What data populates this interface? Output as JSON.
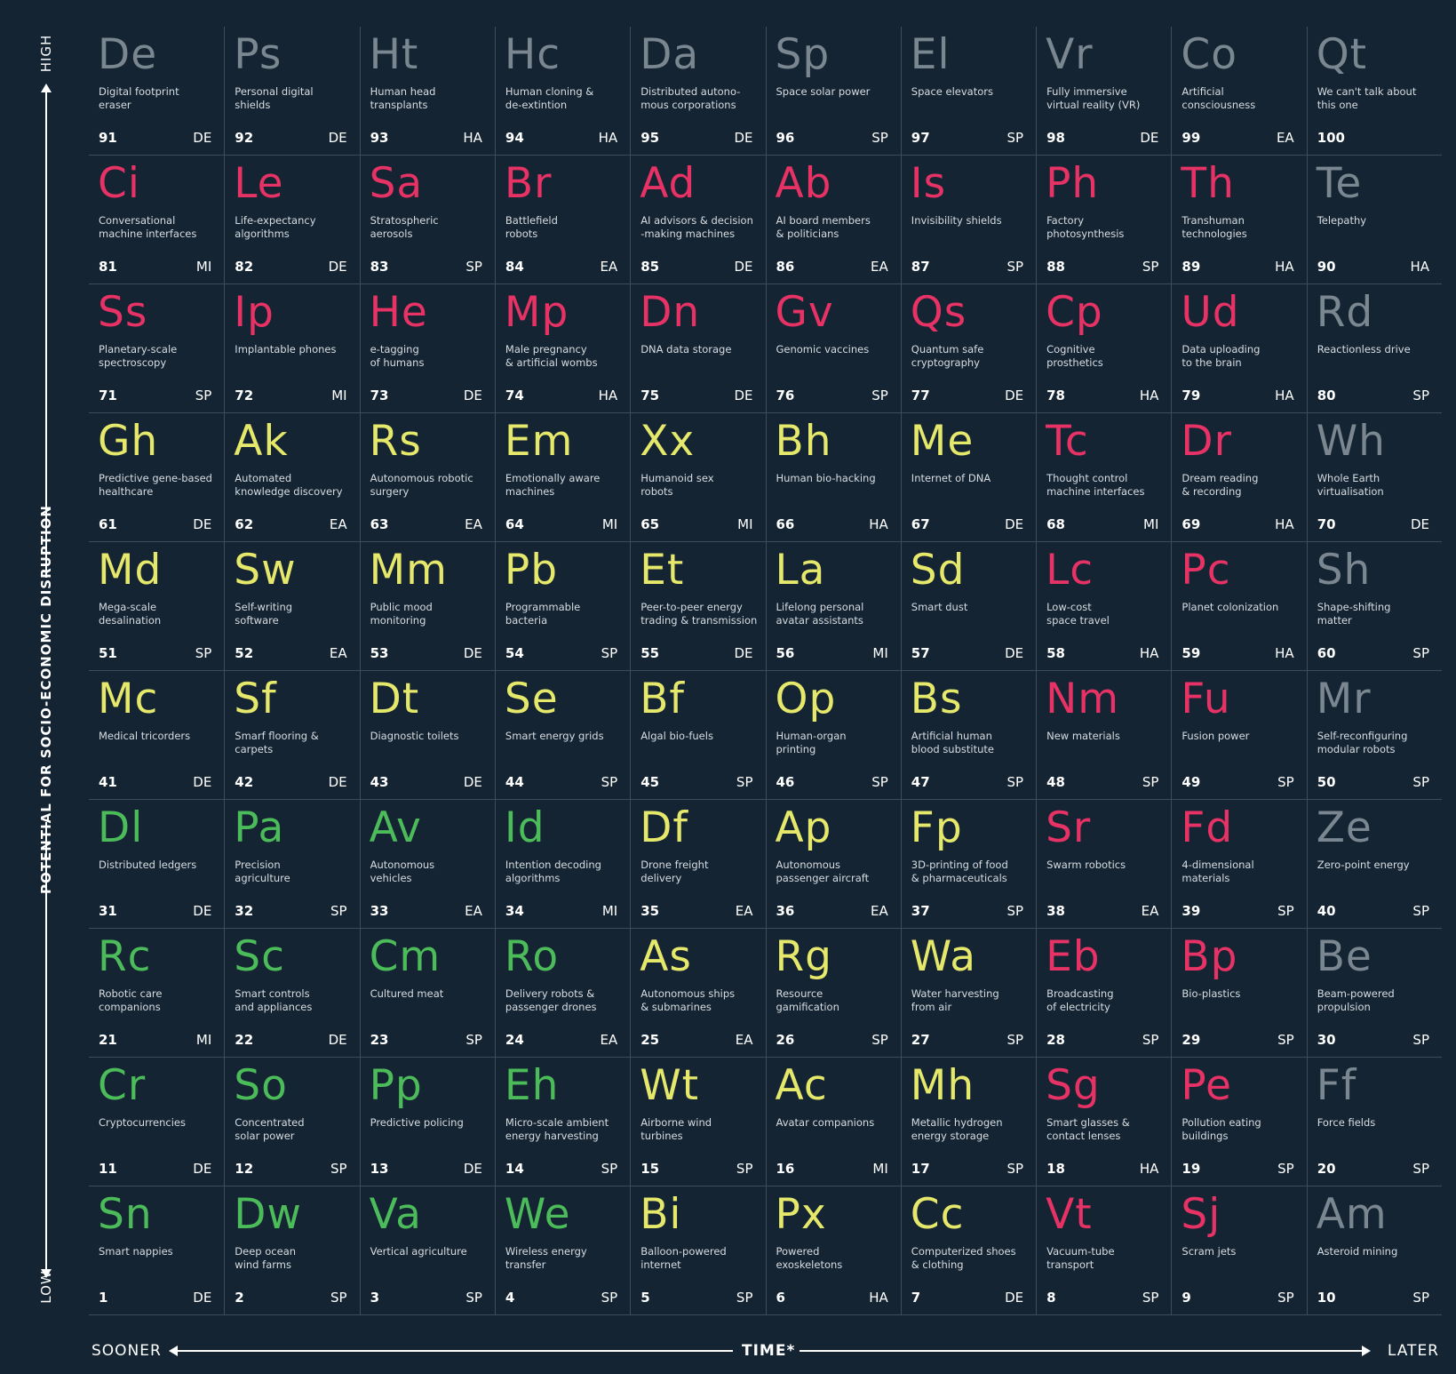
{
  "axis": {
    "y_high": "HIGH",
    "y_low": "LOW",
    "y_label": "POTENTIAL FOR SOCIO-ECONOMIC DISRUPTION",
    "x_sooner": "SOONER",
    "x_later": "LATER",
    "x_label": "TIME*"
  },
  "colors": {
    "background": "#142432",
    "gray": "#7a8690",
    "pink": "#e63265",
    "yellow": "#e5e86a",
    "green": "#4cbb5a"
  },
  "elements": [
    {
      "symbol": "De",
      "name": "Digital footprint\neraser",
      "number": "91",
      "category": "DE",
      "color": "gray"
    },
    {
      "symbol": "Ps",
      "name": "Personal digital\nshields",
      "number": "92",
      "category": "DE",
      "color": "gray"
    },
    {
      "symbol": "Ht",
      "name": "Human head\ntransplants",
      "number": "93",
      "category": "HA",
      "color": "gray"
    },
    {
      "symbol": "Hc",
      "name": "Human cloning &\nde-extintion",
      "number": "94",
      "category": "HA",
      "color": "gray"
    },
    {
      "symbol": "Da",
      "name": "Distributed autono-\nmous corporations",
      "number": "95",
      "category": "DE",
      "color": "gray"
    },
    {
      "symbol": "Sp",
      "name": "Space solar power",
      "number": "96",
      "category": "SP",
      "color": "gray"
    },
    {
      "symbol": "El",
      "name": "Space elevators",
      "number": "97",
      "category": "SP",
      "color": "gray"
    },
    {
      "symbol": "Vr",
      "name": "Fully immersive\nvirtual reality (VR)",
      "number": "98",
      "category": "DE",
      "color": "gray"
    },
    {
      "symbol": "Co",
      "name": "Artificial\nconsciousness",
      "number": "99",
      "category": "EA",
      "color": "gray"
    },
    {
      "symbol": "Qt",
      "name": "We can't talk about\nthis one",
      "number": "100",
      "category": "",
      "color": "gray"
    },
    {
      "symbol": "Ci",
      "name": "Conversational\nmachine interfaces",
      "number": "81",
      "category": "MI",
      "color": "pink"
    },
    {
      "symbol": "Le",
      "name": "Life-expectancy\nalgorithms",
      "number": "82",
      "category": "DE",
      "color": "pink"
    },
    {
      "symbol": "Sa",
      "name": "Stratospheric\naerosols",
      "number": "83",
      "category": "SP",
      "color": "pink"
    },
    {
      "symbol": "Br",
      "name": "Battlefield\nrobots",
      "number": "84",
      "category": "EA",
      "color": "pink"
    },
    {
      "symbol": "Ad",
      "name": "AI advisors & decision\n-making machines",
      "number": "85",
      "category": "DE",
      "color": "pink"
    },
    {
      "symbol": "Ab",
      "name": "AI board members\n& politicians",
      "number": "86",
      "category": "EA",
      "color": "pink"
    },
    {
      "symbol": "Is",
      "name": "Invisibility shields",
      "number": "87",
      "category": "SP",
      "color": "pink"
    },
    {
      "symbol": "Ph",
      "name": "Factory\nphotosynthesis",
      "number": "88",
      "category": "SP",
      "color": "pink"
    },
    {
      "symbol": "Th",
      "name": "Transhuman\ntechnologies",
      "number": "89",
      "category": "HA",
      "color": "pink"
    },
    {
      "symbol": "Te",
      "name": "Telepathy",
      "number": "90",
      "category": "HA",
      "color": "gray"
    },
    {
      "symbol": "Ss",
      "name": "Planetary-scale\nspectroscopy",
      "number": "71",
      "category": "SP",
      "color": "pink"
    },
    {
      "symbol": "Ip",
      "name": "Implantable phones",
      "number": "72",
      "category": "MI",
      "color": "pink"
    },
    {
      "symbol": "He",
      "name": "e-tagging\nof humans",
      "number": "73",
      "category": "DE",
      "color": "pink"
    },
    {
      "symbol": "Mp",
      "name": "Male pregnancy\n& artificial wombs",
      "number": "74",
      "category": "HA",
      "color": "pink"
    },
    {
      "symbol": "Dn",
      "name": "DNA data storage",
      "number": "75",
      "category": "DE",
      "color": "pink"
    },
    {
      "symbol": "Gv",
      "name": "Genomic vaccines",
      "number": "76",
      "category": "SP",
      "color": "pink"
    },
    {
      "symbol": "Qs",
      "name": "Quantum safe\ncryptography",
      "number": "77",
      "category": "DE",
      "color": "pink"
    },
    {
      "symbol": "Cp",
      "name": "Cognitive\nprosthetics",
      "number": "78",
      "category": "HA",
      "color": "pink"
    },
    {
      "symbol": "Ud",
      "name": "Data uploading\nto the brain",
      "number": "79",
      "category": "HA",
      "color": "pink"
    },
    {
      "symbol": "Rd",
      "name": "Reactionless drive",
      "number": "80",
      "category": "SP",
      "color": "gray"
    },
    {
      "symbol": "Gh",
      "name": "Predictive gene-based\nhealthcare",
      "number": "61",
      "category": "DE",
      "color": "yellow"
    },
    {
      "symbol": "Ak",
      "name": "Automated\nknowledge discovery",
      "number": "62",
      "category": "EA",
      "color": "yellow"
    },
    {
      "symbol": "Rs",
      "name": "Autonomous robotic\nsurgery",
      "number": "63",
      "category": "EA",
      "color": "yellow"
    },
    {
      "symbol": "Em",
      "name": "Emotionally aware\nmachines",
      "number": "64",
      "category": "MI",
      "color": "yellow"
    },
    {
      "symbol": "Xx",
      "name": "Humanoid sex\nrobots",
      "number": "65",
      "category": "MI",
      "color": "yellow"
    },
    {
      "symbol": "Bh",
      "name": "Human bio-hacking",
      "number": "66",
      "category": "HA",
      "color": "yellow"
    },
    {
      "symbol": "Me",
      "name": "Internet of DNA",
      "number": "67",
      "category": "DE",
      "color": "yellow"
    },
    {
      "symbol": "Tc",
      "name": "Thought control\nmachine interfaces",
      "number": "68",
      "category": "MI",
      "color": "pink"
    },
    {
      "symbol": "Dr",
      "name": "Dream reading\n& recording",
      "number": "69",
      "category": "HA",
      "color": "pink"
    },
    {
      "symbol": "Wh",
      "name": "Whole Earth\nvirtualisation",
      "number": "70",
      "category": "DE",
      "color": "gray"
    },
    {
      "symbol": "Md",
      "name": "Mega-scale\ndesalination",
      "number": "51",
      "category": "SP",
      "color": "yellow"
    },
    {
      "symbol": "Sw",
      "name": "Self-writing\nsoftware",
      "number": "52",
      "category": "EA",
      "color": "yellow"
    },
    {
      "symbol": "Mm",
      "name": "Public mood\nmonitoring",
      "number": "53",
      "category": "DE",
      "color": "yellow"
    },
    {
      "symbol": "Pb",
      "name": "Programmable\nbacteria",
      "number": "54",
      "category": "SP",
      "color": "yellow"
    },
    {
      "symbol": "Et",
      "name": "Peer-to-peer energy\ntrading & transmission",
      "number": "55",
      "category": "DE",
      "color": "yellow"
    },
    {
      "symbol": "La",
      "name": "Lifelong personal\navatar assistants",
      "number": "56",
      "category": "MI",
      "color": "yellow"
    },
    {
      "symbol": "Sd",
      "name": "Smart dust",
      "number": "57",
      "category": "DE",
      "color": "yellow"
    },
    {
      "symbol": "Lc",
      "name": "Low-cost\nspace travel",
      "number": "58",
      "category": "HA",
      "color": "pink"
    },
    {
      "symbol": "Pc",
      "name": "Planet colonization",
      "number": "59",
      "category": "HA",
      "color": "pink"
    },
    {
      "symbol": "Sh",
      "name": "Shape-shifting\nmatter",
      "number": "60",
      "category": "SP",
      "color": "gray"
    },
    {
      "symbol": "Mc",
      "name": "Medical tricorders",
      "number": "41",
      "category": "DE",
      "color": "yellow"
    },
    {
      "symbol": "Sf",
      "name": "Smarf flooring &\ncarpets",
      "number": "42",
      "category": "DE",
      "color": "yellow"
    },
    {
      "symbol": "Dt",
      "name": "Diagnostic toilets",
      "number": "43",
      "category": "DE",
      "color": "yellow"
    },
    {
      "symbol": "Se",
      "name": "Smart energy grids",
      "number": "44",
      "category": "SP",
      "color": "yellow"
    },
    {
      "symbol": "Bf",
      "name": "Algal bio-fuels",
      "number": "45",
      "category": "SP",
      "color": "yellow"
    },
    {
      "symbol": "Op",
      "name": "Human-organ\nprinting",
      "number": "46",
      "category": "SP",
      "color": "yellow"
    },
    {
      "symbol": "Bs",
      "name": "Artificial human\nblood substitute",
      "number": "47",
      "category": "SP",
      "color": "yellow"
    },
    {
      "symbol": "Nm",
      "name": "New materials",
      "number": "48",
      "category": "SP",
      "color": "pink"
    },
    {
      "symbol": "Fu",
      "name": "Fusion power",
      "number": "49",
      "category": "SP",
      "color": "pink"
    },
    {
      "symbol": "Mr",
      "name": "Self-reconfiguring\nmodular robots",
      "number": "50",
      "category": "SP",
      "color": "gray"
    },
    {
      "symbol": "Dl",
      "name": "Distributed ledgers",
      "number": "31",
      "category": "DE",
      "color": "green"
    },
    {
      "symbol": "Pa",
      "name": "Precision\nagriculture",
      "number": "32",
      "category": "SP",
      "color": "green"
    },
    {
      "symbol": "Av",
      "name": "Autonomous\nvehicles",
      "number": "33",
      "category": "EA",
      "color": "green"
    },
    {
      "symbol": "Id",
      "name": "Intention decoding\nalgorithms",
      "number": "34",
      "category": "MI",
      "color": "green"
    },
    {
      "symbol": "Df",
      "name": "Drone freight\ndelivery",
      "number": "35",
      "category": "EA",
      "color": "yellow"
    },
    {
      "symbol": "Ap",
      "name": "Autonomous\npassenger aircraft",
      "number": "36",
      "category": "EA",
      "color": "yellow"
    },
    {
      "symbol": "Fp",
      "name": "3D-printing of food\n& pharmaceuticals",
      "number": "37",
      "category": "SP",
      "color": "yellow"
    },
    {
      "symbol": "Sr",
      "name": "Swarm robotics",
      "number": "38",
      "category": "EA",
      "color": "pink"
    },
    {
      "symbol": "Fd",
      "name": "4-dimensional\nmaterials",
      "number": "39",
      "category": "SP",
      "color": "pink"
    },
    {
      "symbol": "Ze",
      "name": "Zero-point energy",
      "number": "40",
      "category": "SP",
      "color": "gray"
    },
    {
      "symbol": "Rc",
      "name": "Robotic care\ncompanions",
      "number": "21",
      "category": "MI",
      "color": "green"
    },
    {
      "symbol": "Sc",
      "name": "Smart controls\nand appliances",
      "number": "22",
      "category": "DE",
      "color": "green"
    },
    {
      "symbol": "Cm",
      "name": "Cultured meat",
      "number": "23",
      "category": "SP",
      "color": "green"
    },
    {
      "symbol": "Ro",
      "name": "Delivery robots &\npassenger drones",
      "number": "24",
      "category": "EA",
      "color": "green"
    },
    {
      "symbol": "As",
      "name": "Autonomous ships\n& submarines",
      "number": "25",
      "category": "EA",
      "color": "yellow"
    },
    {
      "symbol": "Rg",
      "name": "Resource\ngamification",
      "number": "26",
      "category": "SP",
      "color": "yellow"
    },
    {
      "symbol": "Wa",
      "name": "Water harvesting\nfrom air",
      "number": "27",
      "category": "SP",
      "color": "yellow"
    },
    {
      "symbol": "Eb",
      "name": "Broadcasting\nof electricity",
      "number": "28",
      "category": "SP",
      "color": "pink"
    },
    {
      "symbol": "Bp",
      "name": "Bio-plastics",
      "number": "29",
      "category": "SP",
      "color": "pink"
    },
    {
      "symbol": "Be",
      "name": "Beam-powered\npropulsion",
      "number": "30",
      "category": "SP",
      "color": "gray"
    },
    {
      "symbol": "Cr",
      "name": "Cryptocurrencies",
      "number": "11",
      "category": "DE",
      "color": "green"
    },
    {
      "symbol": "So",
      "name": "Concentrated\nsolar power",
      "number": "12",
      "category": "SP",
      "color": "green"
    },
    {
      "symbol": "Pp",
      "name": "Predictive policing",
      "number": "13",
      "category": "DE",
      "color": "green"
    },
    {
      "symbol": "Eh",
      "name": "Micro-scale ambient\nenergy harvesting",
      "number": "14",
      "category": "SP",
      "color": "green"
    },
    {
      "symbol": "Wt",
      "name": "Airborne wind\nturbines",
      "number": "15",
      "category": "SP",
      "color": "yellow"
    },
    {
      "symbol": "Ac",
      "name": "Avatar companions",
      "number": "16",
      "category": "MI",
      "color": "yellow"
    },
    {
      "symbol": "Mh",
      "name": "Metallic hydrogen\nenergy storage",
      "number": "17",
      "category": "SP",
      "color": "yellow"
    },
    {
      "symbol": "Sg",
      "name": "Smart glasses &\ncontact lenses",
      "number": "18",
      "category": "HA",
      "color": "pink"
    },
    {
      "symbol": "Pe",
      "name": "Pollution eating\nbuildings",
      "number": "19",
      "category": "SP",
      "color": "pink"
    },
    {
      "symbol": "Ff",
      "name": "Force fields",
      "number": "20",
      "category": "SP",
      "color": "gray"
    },
    {
      "symbol": "Sn",
      "name": "Smart nappies",
      "number": "1",
      "category": "DE",
      "color": "green"
    },
    {
      "symbol": "Dw",
      "name": "Deep ocean\nwind farms",
      "number": "2",
      "category": "SP",
      "color": "green"
    },
    {
      "symbol": "Va",
      "name": "Vertical agriculture",
      "number": "3",
      "category": "SP",
      "color": "green"
    },
    {
      "symbol": "We",
      "name": "Wireless energy\ntransfer",
      "number": "4",
      "category": "SP",
      "color": "green"
    },
    {
      "symbol": "Bi",
      "name": "Balloon-powered\ninternet",
      "number": "5",
      "category": "SP",
      "color": "yellow"
    },
    {
      "symbol": "Px",
      "name": "Powered\nexoskeletons",
      "number": "6",
      "category": "HA",
      "color": "yellow"
    },
    {
      "symbol": "Cc",
      "name": "Computerized shoes\n& clothing",
      "number": "7",
      "category": "DE",
      "color": "yellow"
    },
    {
      "symbol": "Vt",
      "name": "Vacuum-tube\ntransport",
      "number": "8",
      "category": "SP",
      "color": "pink"
    },
    {
      "symbol": "Sj",
      "name": "Scram jets",
      "number": "9",
      "category": "SP",
      "color": "pink"
    },
    {
      "symbol": "Am",
      "name": "Asteroid mining",
      "number": "10",
      "category": "SP",
      "color": "gray"
    }
  ]
}
